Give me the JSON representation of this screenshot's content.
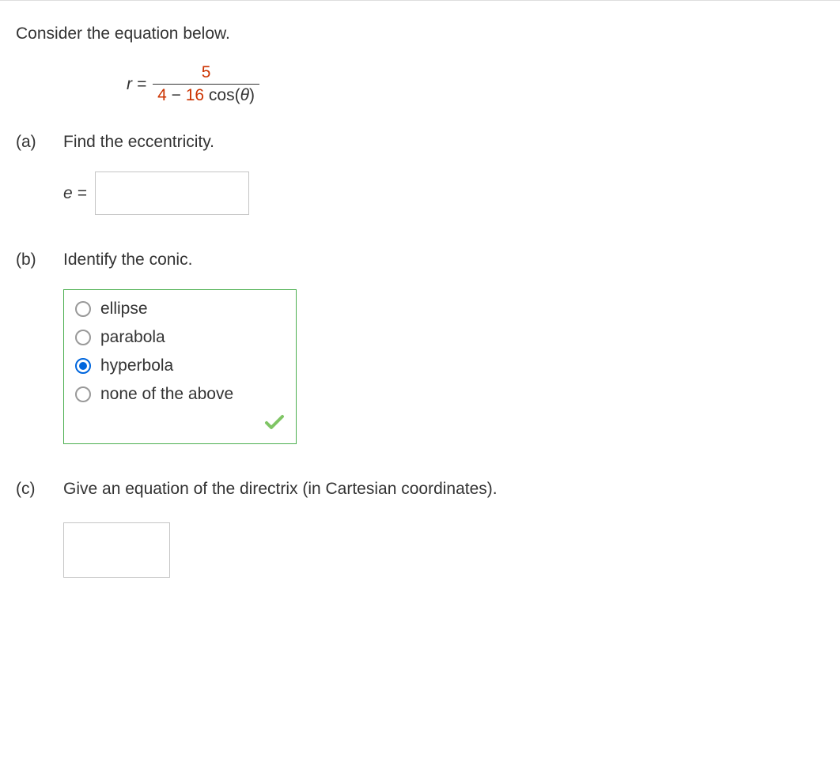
{
  "intro": "Consider the equation below.",
  "equation": {
    "lhs": "r =",
    "numerator": "5",
    "denom_num1": "4",
    "denom_minus": " − ",
    "denom_num2": "16",
    "denom_cos": " cos(",
    "denom_theta": "θ",
    "denom_close": ")"
  },
  "parts": {
    "a": {
      "label": "(a)",
      "prompt": "Find the eccentricity.",
      "answer_label": "e ="
    },
    "b": {
      "label": "(b)",
      "prompt": "Identify the conic.",
      "options": [
        {
          "label": "ellipse",
          "selected": false
        },
        {
          "label": "parabola",
          "selected": false
        },
        {
          "label": "hyperbola",
          "selected": true
        },
        {
          "label": "none of the above",
          "selected": false
        }
      ]
    },
    "c": {
      "label": "(c)",
      "prompt": "Give an equation of the directrix (in Cartesian coordinates)."
    }
  }
}
